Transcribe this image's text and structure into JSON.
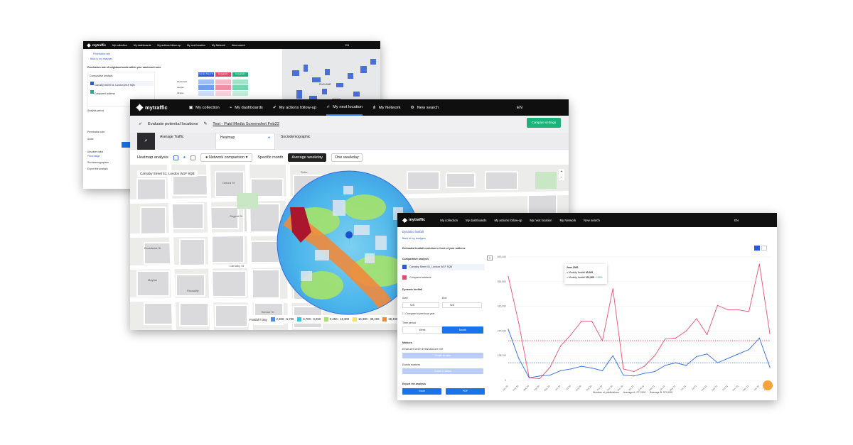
{
  "app": {
    "logo_text": "mytraffic"
  },
  "nav": {
    "collection": "My collection",
    "dashboards": "My dashboards",
    "actions": "My actions follow-up",
    "next_location": "My next location",
    "network": "My Network",
    "new_search": "New search",
    "lang": "EN"
  },
  "window1": {
    "title": "Penetration rate",
    "back": "Back to my analyses",
    "subtitle": "Penetration rate of neighbourhoods within your catchment zone",
    "comparative": "Comparative analysis",
    "loc1": "Carnaby Street 51, London W1F 9QB",
    "loc2": "Compared address",
    "analysis_period": "Analysis period",
    "penetration_rate": "Penetration rate",
    "scale": "Scale",
    "absolute": "Absolute value",
    "percentage": "Percentage",
    "sociodemographics": "Sociodemographics",
    "export": "Export the analysis",
    "columns": [
      "Carnaby Street 51",
      "Compared 1",
      "Compared 2"
    ],
    "rows": [
      "Westminster",
      "Camden",
      "Islington"
    ],
    "map_label": "ENGLAND"
  },
  "window2": {
    "evaluate": "Evaluate potential locations",
    "title": "Test - Paid Media Screenshot Feb22",
    "compare": "Compare settings",
    "tabs": [
      "Average Traffic",
      "Heatmap",
      "Sociodemographic"
    ],
    "heatmap_analysis": "Heatmap analysis",
    "network_comparison": "Network comparison",
    "specific_month": "Specific month",
    "average_weekday": "Average weekday",
    "one_weekday": "One weekday",
    "address": "Carnaby Street 51, London W1F 9QB",
    "legend_title": "Footfall / Day",
    "legend": [
      {
        "label": "2,300 - 5,700",
        "color": "#4a90e2"
      },
      {
        "label": "5,700 - 9,250",
        "color": "#36c3e8"
      },
      {
        "label": "9,250 - 16,300",
        "color": "#a6e36b"
      },
      {
        "label": "16,300 - 38,400",
        "color": "#f4e26b"
      },
      {
        "label": "38,400",
        "color": "#f08a3c"
      }
    ],
    "streets": [
      "Oxford St",
      "Regent St",
      "Broadwick St",
      "Soho",
      "Piccadilly",
      "Mayfair",
      "Carnaby St",
      "Brewer St"
    ]
  },
  "window3": {
    "title": "Dynamic footfall",
    "back": "Back to my analyses",
    "estimated": "Estimated footfall evolution in front of your address",
    "comparative": "Comparative analysis",
    "loc1": "Carnaby Street 51, London W1F 9QB",
    "loc2": "Compared address",
    "dyn": "Dynamic footfall",
    "start": "Start",
    "end": "End",
    "start_val": "N/A",
    "end_val": "N/A",
    "compare_prev": "Compare to previous year",
    "time_period": "Time period",
    "week": "Week",
    "month": "Month",
    "markers": "Markers",
    "email_alert": "Email alert when thresholds are met",
    "create_alert": "Create an alert",
    "events_markers": "Events markers",
    "create_event": "Create a marker",
    "export": "Export the analysis",
    "excel": "Excel",
    "pdf": "PDF",
    "tooltip": {
      "title": "June 2020",
      "r1_label": "Monthly footfall",
      "r1_val": "40,000",
      "r2_label": "Monthly footfall",
      "r2_val": "101,900",
      "change": "+155%"
    },
    "legend": [
      "Number of publications",
      "Average A: 277,000",
      "Average B: 579,000"
    ]
  },
  "chart_data": {
    "type": "line",
    "categories": [
      "Jan 20",
      "Feb 20",
      "Mar 20",
      "Apr 20",
      "May 20",
      "Jun 20",
      "Jul 20",
      "Aug 20",
      "Sep 20",
      "Oct 20",
      "Nov 20",
      "Dec 20",
      "Jan 21",
      "Feb 21",
      "Mar 21",
      "Apr 21",
      "May 21",
      "Jun 21",
      "Jul 21",
      "Aug 21",
      "Sep 21",
      "Oct 21",
      "Nov 21",
      "Dec 21",
      "Jan 22",
      "Feb 22"
    ],
    "yticks": [
      "0",
      "138,700",
      "277,400",
      "416,000",
      "554,800",
      "693,400"
    ],
    "series": [
      {
        "color": "#e8526f",
        "values": [
          1.18,
          0.65,
          0.03,
          0.02,
          0.15,
          0.39,
          0.52,
          0.67,
          0.67,
          0.45,
          1.04,
          0.13,
          0.1,
          0.16,
          0.28,
          0.47,
          0.48,
          0.56,
          0.7,
          0.52,
          0.85,
          0.8,
          0.8,
          0.78,
          1.32,
          0.53
        ]
      },
      {
        "color": "#2d6be4",
        "values": [
          0.58,
          0.25,
          0.03,
          0.05,
          0.06,
          0.11,
          0.13,
          0.16,
          0.14,
          0.11,
          0.28,
          0.06,
          0.05,
          0.08,
          0.1,
          0.17,
          0.2,
          0.17,
          0.27,
          0.3,
          0.2,
          0.25,
          0.3,
          0.35,
          0.48,
          0.15
        ]
      }
    ],
    "averages": [
      {
        "color": "#e8526f",
        "value": 0.45
      },
      {
        "color": "#2d6be4",
        "value": 0.2
      }
    ],
    "ylim": [
      0,
      1.4
    ]
  }
}
